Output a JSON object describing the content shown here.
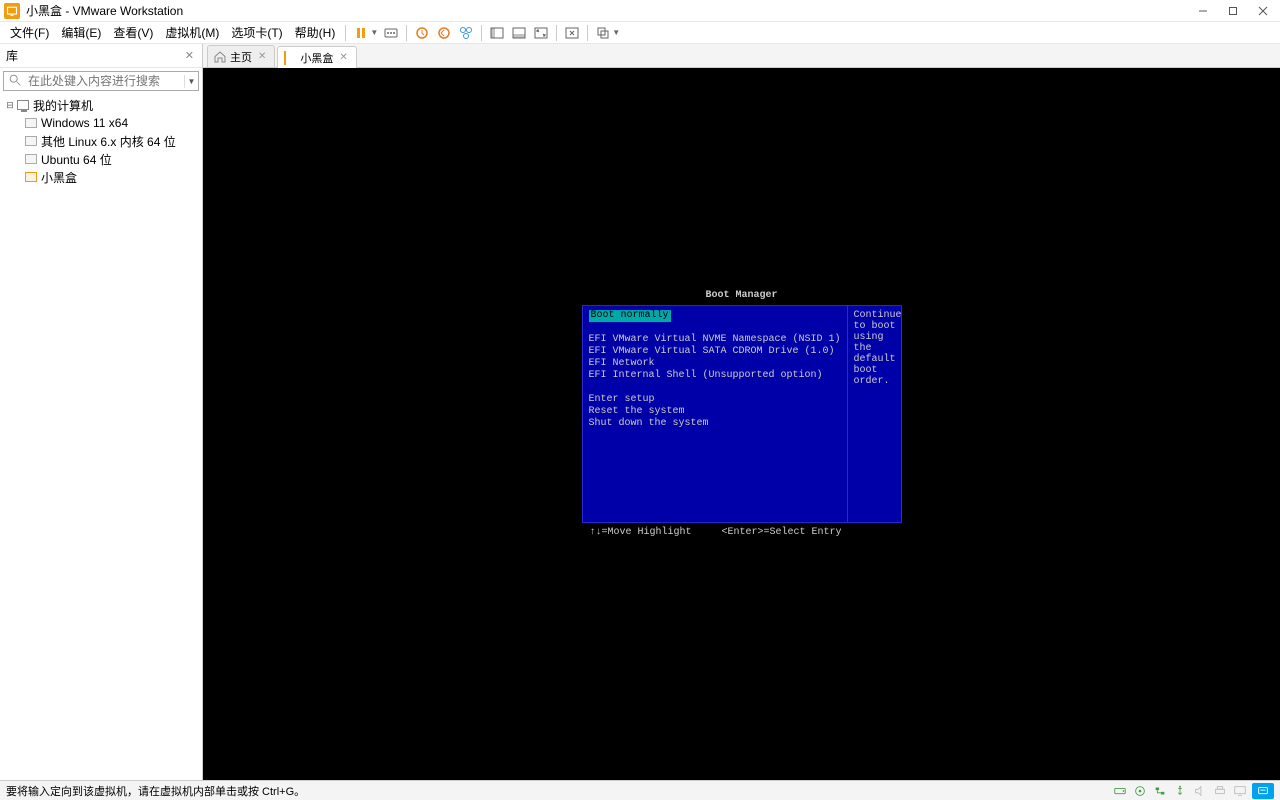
{
  "window": {
    "title": "小黑盒 - VMware Workstation"
  },
  "menu": {
    "file": "文件(F)",
    "edit": "编辑(E)",
    "view": "查看(V)",
    "vm": "虚拟机(M)",
    "tabs": "选项卡(T)",
    "help": "帮助(H)"
  },
  "library": {
    "title": "库",
    "search_placeholder": "在此处键入内容进行搜索",
    "root": "我的计算机",
    "items": [
      {
        "label": "Windows 11 x64",
        "active": false
      },
      {
        "label": "其他 Linux 6.x 内核 64 位",
        "active": false
      },
      {
        "label": "Ubuntu 64 位",
        "active": false
      },
      {
        "label": "小黑盒",
        "active": true
      }
    ]
  },
  "tabs": {
    "home": "主页",
    "current": "小黑盒"
  },
  "boot": {
    "title": "Boot Manager",
    "selected": "Boot normally",
    "entries": [
      "EFI VMware Virtual NVME Namespace (NSID 1)",
      "EFI VMware Virtual SATA CDROM Drive (1.0)",
      "EFI Network",
      "EFI Internal Shell (Unsupported option)"
    ],
    "actions": [
      "Enter setup",
      "Reset the system",
      "Shut down the system"
    ],
    "help": "Continue to boot using the default boot order.",
    "footer_move": "↑↓=Move Highlight",
    "footer_enter": "<Enter>=Select Entry"
  },
  "status": {
    "message": "要将输入定向到该虚拟机，请在虚拟机内部单击或按 Ctrl+G。"
  }
}
